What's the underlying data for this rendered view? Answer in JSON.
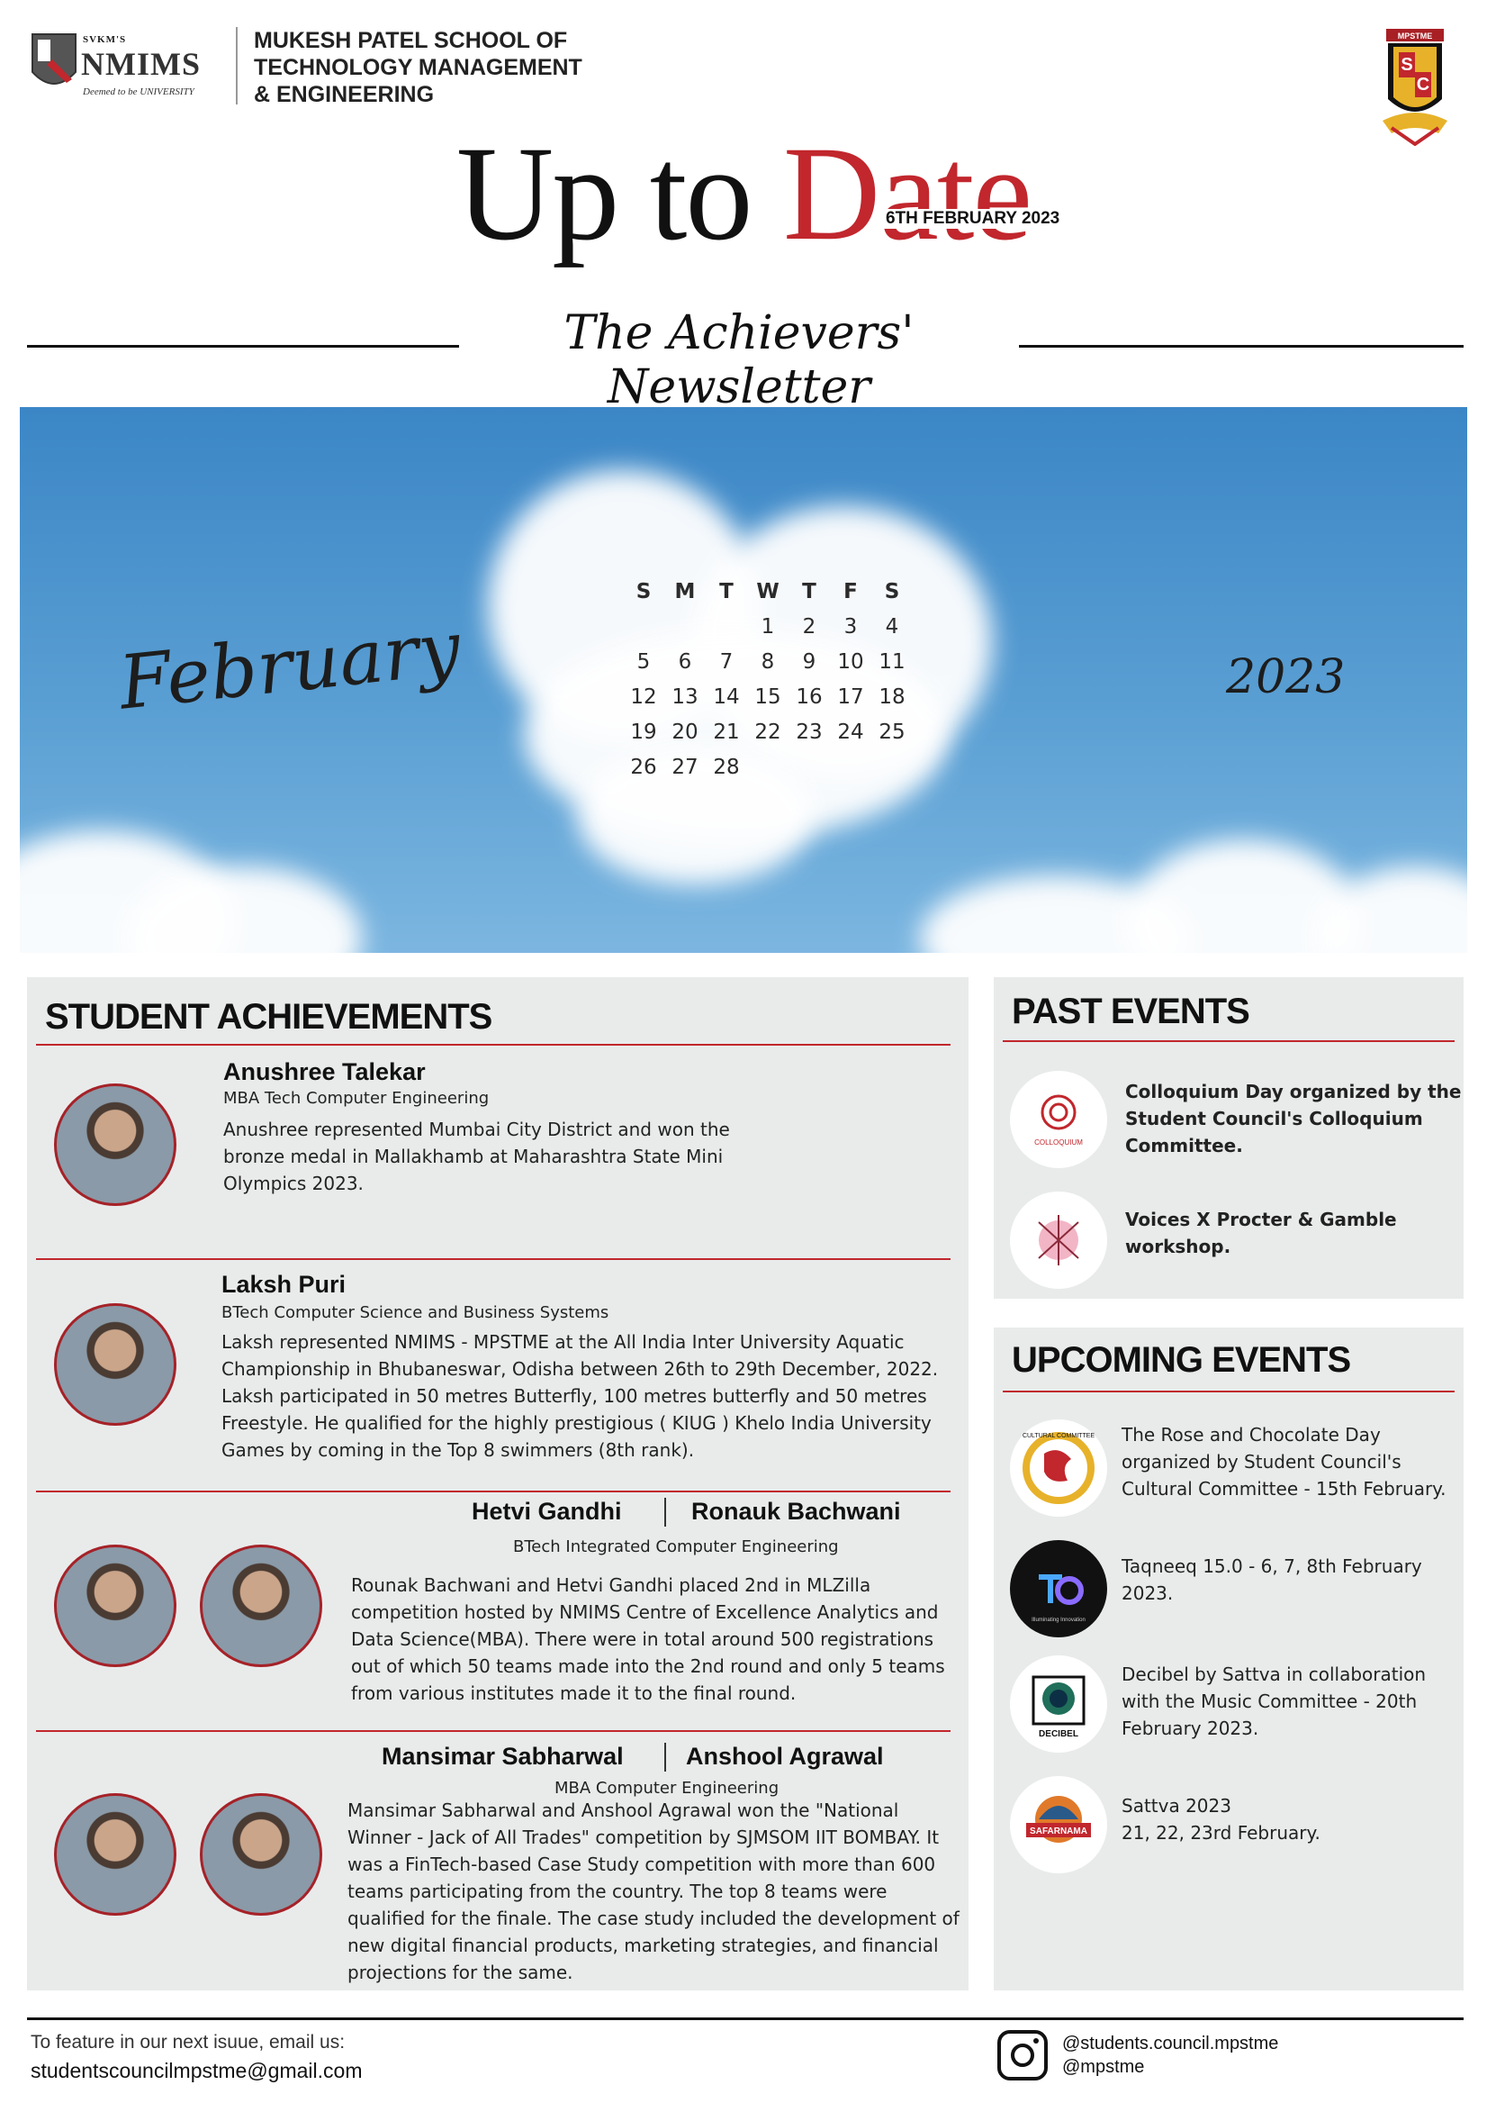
{
  "header": {
    "logo_small": "SVKM'S",
    "logo_big": "NMIMS",
    "logo_tagline": "Deemed to be UNIVERSITY",
    "school_name": "MUKESH PATEL SCHOOL OF\nTECHNOLOGY MANAGEMENT\n& ENGINEERING",
    "sc_logo_label": "MPSTME",
    "sc_letters": [
      "S",
      "C"
    ]
  },
  "masthead": {
    "title_part1": "Up to",
    "title_part2": "Date",
    "date": "6TH FEBRUARY 2023",
    "subtitle": "The Achievers' Newsletter"
  },
  "calendar": {
    "month": "February",
    "year": "2023",
    "weekdays": [
      "S",
      "M",
      "T",
      "W",
      "T",
      "F",
      "S"
    ],
    "weeks": [
      [
        "",
        "",
        "",
        "1",
        "2",
        "3",
        "4"
      ],
      [
        "5",
        "6",
        "7",
        "8",
        "9",
        "10",
        "11"
      ],
      [
        "12",
        "13",
        "14",
        "15",
        "16",
        "17",
        "18"
      ],
      [
        "19",
        "20",
        "21",
        "22",
        "23",
        "24",
        "25"
      ],
      [
        "26",
        "27",
        "28",
        "",
        "",
        "",
        ""
      ]
    ]
  },
  "achievements": {
    "title": "STUDENT ACHIEVEMENTS",
    "items": [
      {
        "name": "Anushree Talekar",
        "program": "MBA Tech Computer Engineering",
        "text": "Anushree represented Mumbai City District and won the bronze medal in Mallakhamb at Maharashtra State Mini Olympics 2023."
      },
      {
        "name": "Laksh Puri",
        "program": "BTech Computer Science and Business Systems",
        "text": "Laksh represented NMIMS - MPSTME at the All India Inter University Aquatic Championship in Bhubaneswar, Odisha between 26th to 29th December, 2022. Laksh participated in 50 metres Butterfly, 100 metres butterfly and 50 metres Freestyle. He qualified for the highly prestigious ( KIUG ) Khelo India University Games by coming in the Top 8 swimmers (8th rank)."
      },
      {
        "name_a": "Hetvi Gandhi",
        "name_b": "Ronauk Bachwani",
        "program": "BTech Integrated Computer Engineering",
        "text": "Rounak Bachwani and Hetvi Gandhi placed 2nd in MLZilla competition hosted by NMIMS Centre of Excellence Analytics and Data Science(MBA). There were in total around 500 registrations out of which 50 teams made into the 2nd round and only 5 teams from various institutes made it to the final round."
      },
      {
        "name_a": "Mansimar Sabharwal",
        "name_b": "Anshool Agrawal",
        "program": "MBA Computer Engineering",
        "text": "Mansimar Sabharwal and Anshool Agrawal won the \"National Winner - Jack of All Trades\" competition by SJMSOM IIT BOMBAY. It was a FinTech-based Case Study competition with more than 600 teams participating from the country. The top 8 teams were qualified for the finale. The case study included the development of new digital financial products, marketing strategies, and financial projections for the same."
      }
    ]
  },
  "past_events": {
    "title": "PAST EVENTS",
    "items": [
      {
        "icon_label": "COLLOQUIUM",
        "text": "Colloquium Day organized by the Student Council's Colloquium Committee."
      },
      {
        "icon_label": "",
        "text": "Voices X Procter & Gamble workshop."
      }
    ]
  },
  "upcoming_events": {
    "title": "UPCOMING EVENTS",
    "items": [
      {
        "icon_label": "CULTURAL COMMITTEE",
        "text": "The Rose and Chocolate Day organized by Student Council's Cultural Committee - 15th February."
      },
      {
        "icon_label": "Illuminating Innovation",
        "text": "Taqneeq 15.0 - 6, 7, 8th February 2023."
      },
      {
        "icon_label": "DECIBEL",
        "text": "Decibel by Sattva in collaboration with the Music Committee - 20th February 2023."
      },
      {
        "icon_label": "SAFARNAMA",
        "text": "Sattva 2023\n21, 22, 23rd February."
      }
    ]
  },
  "footer": {
    "line1": "To feature in our next isuue, email us:",
    "email": "studentscouncilmpstme@gmail.com",
    "handle1": "@students.council.mpstme",
    "handle2": "@mpstme"
  },
  "colors": {
    "accent_red": "#c1272d",
    "panel_bg": "#e9ebeb",
    "sky_blue": "#3b86c6"
  }
}
